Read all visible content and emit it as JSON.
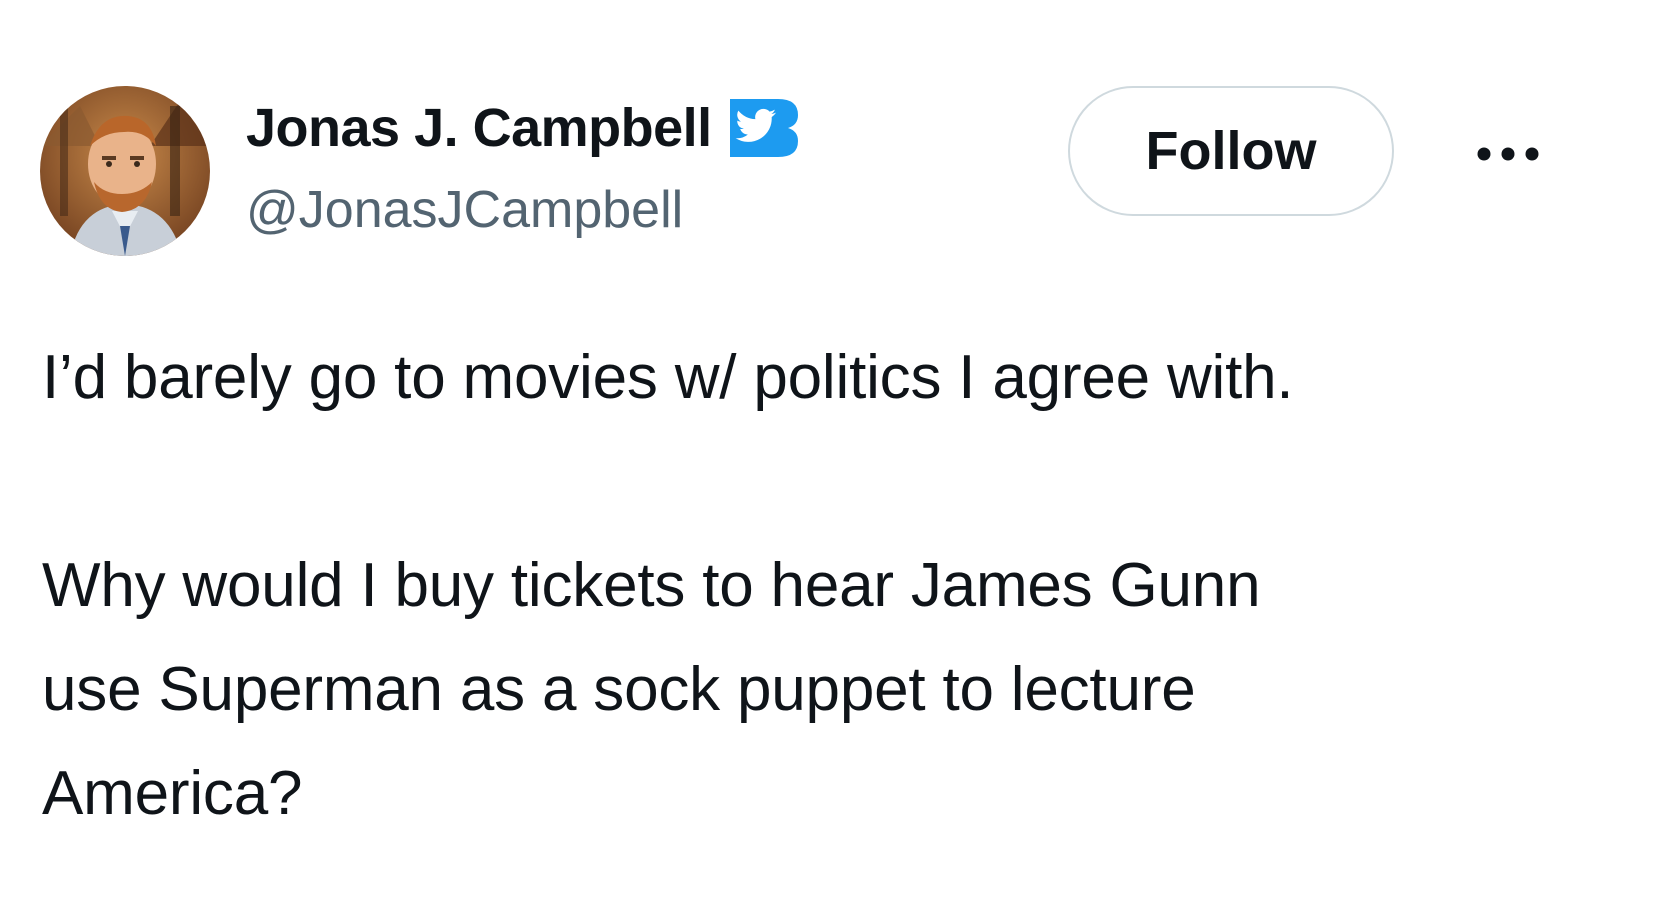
{
  "author": {
    "display_name": "Jonas J. Campbell",
    "handle": "@JonasJCampbell",
    "verified": true,
    "avatar_icon": "user-avatar-portrait",
    "badge_icon": "verified-bird-badge-icon",
    "badge_color": "#1d9bf0"
  },
  "actions": {
    "follow_label": "Follow",
    "more_icon": "more-options-icon"
  },
  "tweet": {
    "line_1": "I’d barely go to movies w/ politics I agree with.",
    "line_2": "Why would I buy tickets to hear James Gunn",
    "line_3": "use Superman as a sock puppet to lecture",
    "line_4": "America?"
  },
  "colors": {
    "text": "#0f1419",
    "secondary_text": "#536471",
    "border": "#cfd9de",
    "accent": "#1d9bf0"
  }
}
